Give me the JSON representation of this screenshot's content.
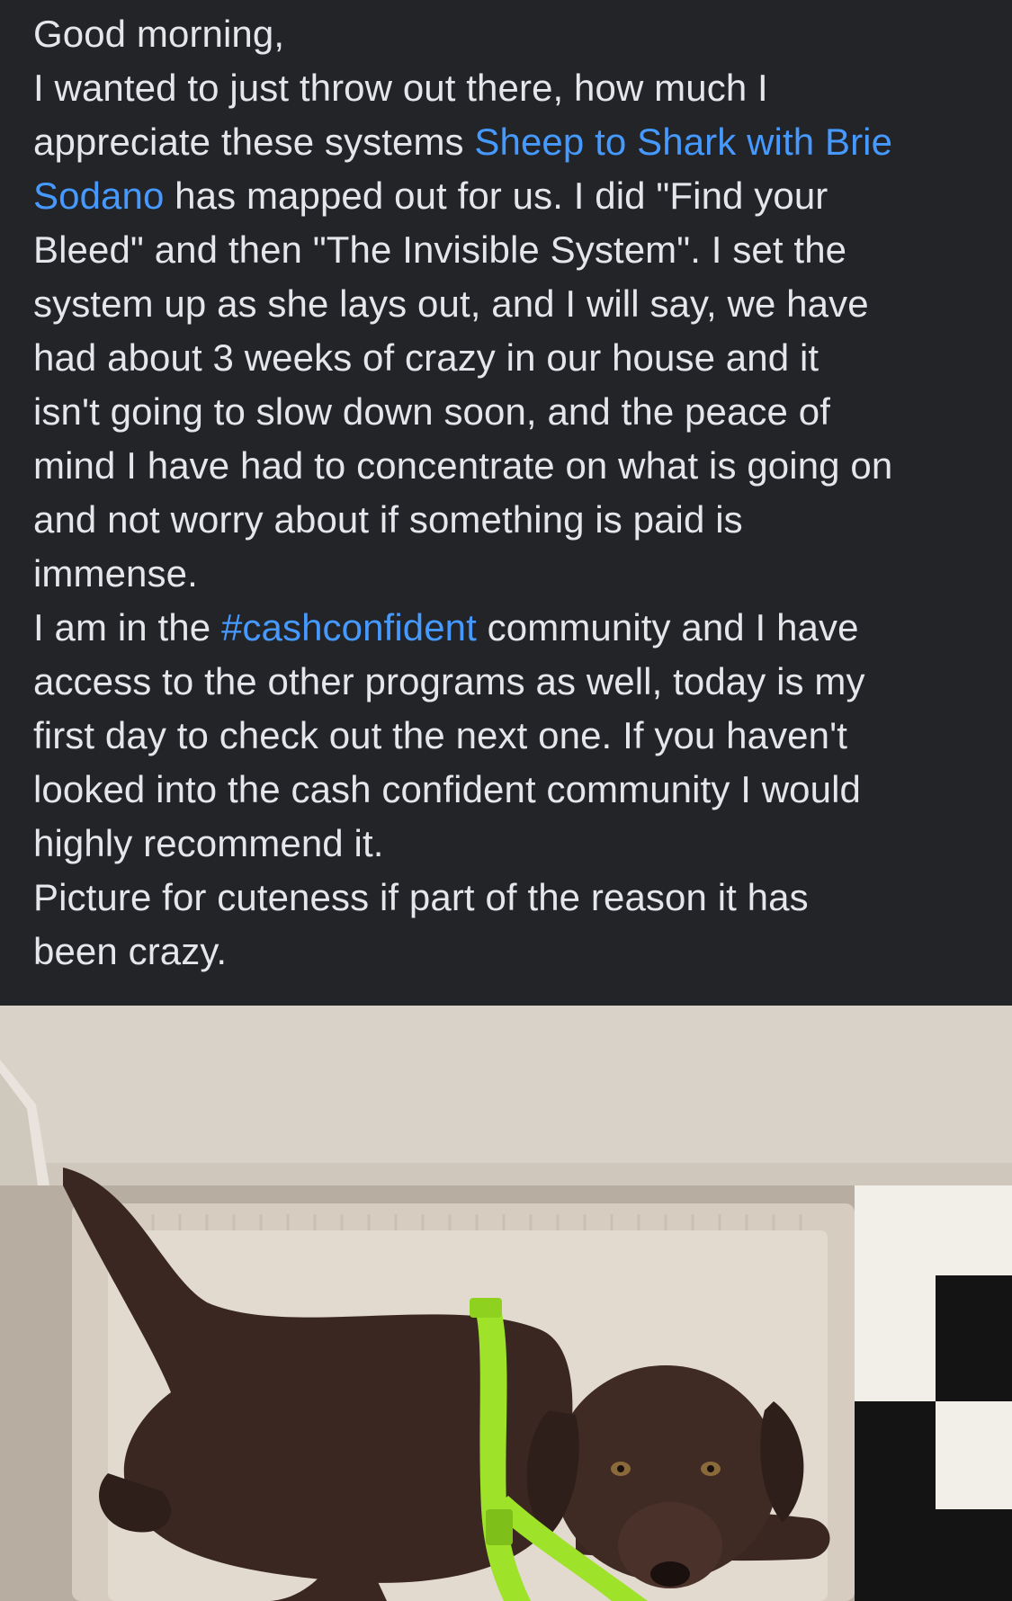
{
  "post": {
    "lines": [
      {
        "t": "Good morning,"
      },
      {
        "t": "I wanted to just throw out there, how much I"
      },
      {
        "t1": "appreciate these systems ",
        "l": "Sheep to Shark with Brie"
      },
      {
        "l": "Sodano",
        "t2": " has mapped out for us.  I did \"Find your"
      },
      {
        "t": "Bleed\" and then \"The Invisible System\". I set the"
      },
      {
        "t": "system up as she lays out, and I will say, we have"
      },
      {
        "t": "had about 3 weeks of crazy in our house and it"
      },
      {
        "t": "isn't going to slow down soon, and the peace of"
      },
      {
        "t": "mind I have had to concentrate on what is going on"
      },
      {
        "t": "and not worry about if something is paid is"
      },
      {
        "t": "immense."
      },
      {
        "t1": "I am in the ",
        "l": "#cashconfident",
        "t2": " community and I have"
      },
      {
        "t": "access to the other programs as well, today is my"
      },
      {
        "t": "first day to check out the next one.  If you haven't"
      },
      {
        "t": "looked into the cash confident community I would"
      },
      {
        "t": "highly recommend it."
      },
      {
        "t": "Picture for cuteness if part of the reason it has"
      },
      {
        "t": "been crazy."
      }
    ],
    "colors": {
      "background": "#232427",
      "text": "#e4e6eb",
      "link": "#4599ff"
    },
    "photo": {
      "icon": "dog-photo"
    }
  }
}
